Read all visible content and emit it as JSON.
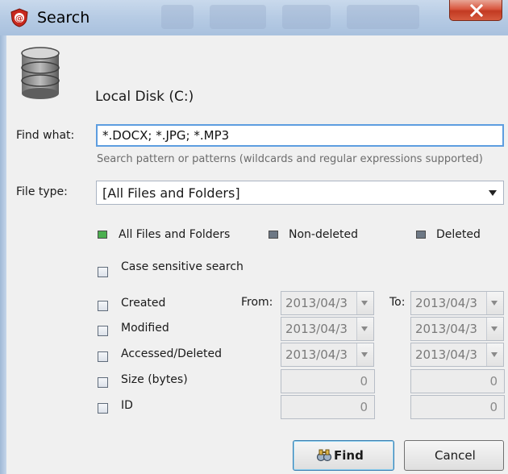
{
  "window": {
    "title": "Search"
  },
  "disk": {
    "label": "Local Disk (C:)"
  },
  "find_what": {
    "label": "Find what:",
    "value": "*.DOCX; *.JPG; *.MP3",
    "hint": "Search pattern or patterns (wildcards and regular expressions supported)"
  },
  "file_type": {
    "label": "File type:",
    "selected": "[All Files and Folders]"
  },
  "filters": {
    "all": {
      "label": "All Files and Folders",
      "color": "#4caf50"
    },
    "non_deleted": {
      "label": "Non-deleted",
      "color": "#6d7885"
    },
    "deleted": {
      "label": "Deleted",
      "color": "#6d7885"
    }
  },
  "case_sensitive": {
    "label": "Case sensitive search",
    "checked": false
  },
  "criteria": {
    "from_label": "From:",
    "to_label": "To:",
    "rows": [
      {
        "label": "Created",
        "from": "2013/04/3",
        "to": "2013/04/3"
      },
      {
        "label": "Modified",
        "from": "2013/04/3",
        "to": "2013/04/3"
      },
      {
        "label": "Accessed/Deleted",
        "from": "2013/04/3",
        "to": "2013/04/3"
      },
      {
        "label": "Size (bytes)",
        "from": "0",
        "to": "0"
      },
      {
        "label": "ID",
        "from": "0",
        "to": "0"
      }
    ]
  },
  "buttons": {
    "find": "Find",
    "cancel": "Cancel"
  },
  "icons": {
    "app": "app-shield-icon",
    "close": "close-icon",
    "disk": "database-disk-icon",
    "find": "search-binoculars-icon"
  }
}
